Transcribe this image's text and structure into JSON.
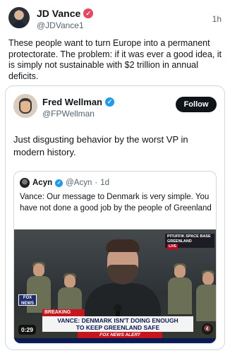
{
  "post": {
    "author_name": "JD Vance",
    "author_handle": "@JDVance1",
    "time": "1h",
    "text": "These people want to turn Europe into a permanent protectorate. The problem: if it was ever a good idea, it is simply not sustainable with $2 trillion in annual deficits.",
    "badge_color": "#e8475f"
  },
  "quoted_post": {
    "author_name": "Fred Wellman",
    "author_handle": "@FPWellman",
    "follow_label": "Follow",
    "text": "Just disgusting behavior by the worst VP in modern history.",
    "badge_color": "#1d9bf0"
  },
  "nested_quote": {
    "author_name": "Acyn",
    "author_handle": "@Acyn",
    "separator": "·",
    "time": "1d",
    "text": "Vance: Our message to Denmark is very simple. You have not done a good job by the people of Greenland"
  },
  "video": {
    "location_line1": "PITUFFIK SPACE BASE",
    "location_line2": "GREENLAND",
    "live_label": "LIVE",
    "network_logo": "FOX NEWS",
    "breaking_label": "BREAKING NEWS",
    "headline_line1": "VANCE: DENMARK ISN'T DOING ENOUGH",
    "headline_line2": "TO KEEP GREENLAND SAFE",
    "alert_label": "FOX NEWS ALERT",
    "timestamp": "0:29",
    "mute_icon": "speaker-muted-icon"
  },
  "colors": {
    "follow_bg": "#0f1419",
    "fox_red": "#c4161c",
    "fox_blue": "#0b1a55"
  }
}
